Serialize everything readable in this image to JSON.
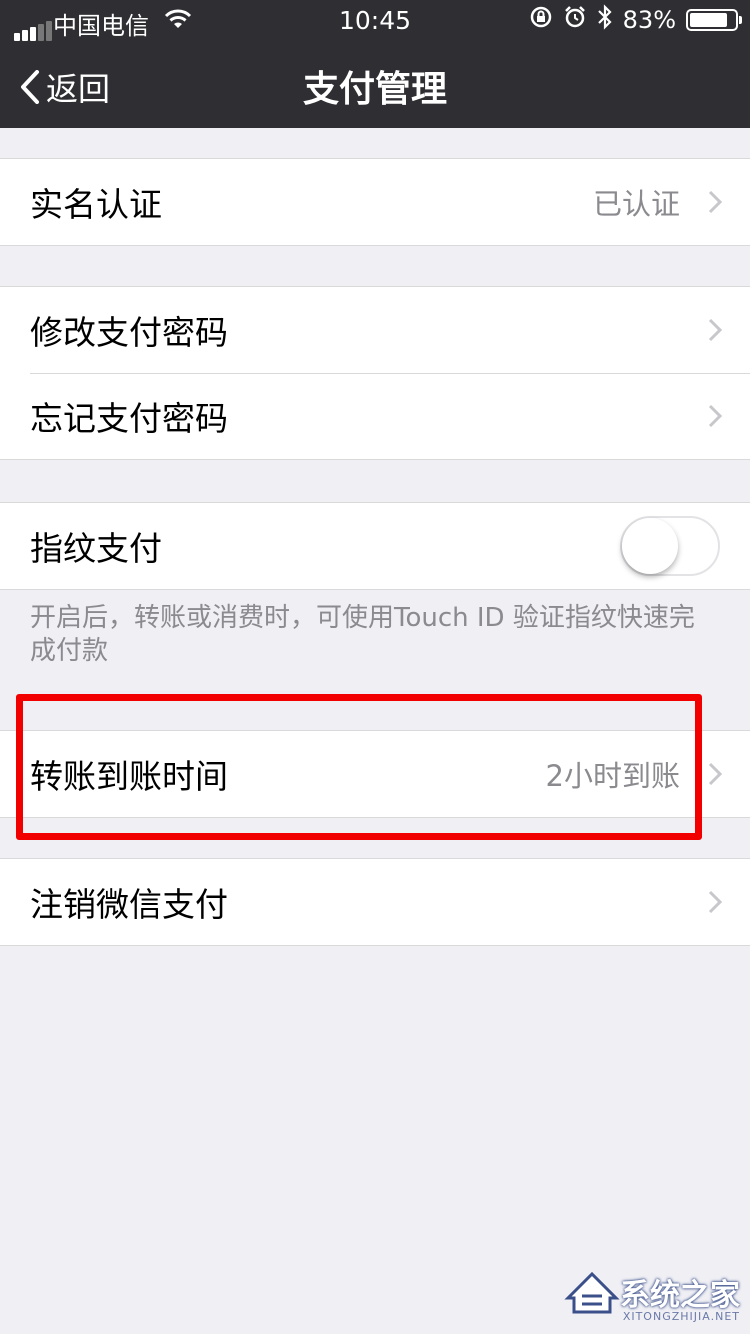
{
  "status_bar": {
    "carrier": "中国电信",
    "time": "10:45",
    "battery": "83%",
    "battery_level": 0.83
  },
  "nav": {
    "back_label": "返回",
    "title": "支付管理"
  },
  "rows": {
    "real_name": {
      "label": "实名认证",
      "value": "已认证"
    },
    "change_password": {
      "label": "修改支付密码"
    },
    "forgot_password": {
      "label": "忘记支付密码"
    },
    "fingerprint": {
      "label": "指纹支付",
      "enabled": false
    },
    "fingerprint_note": "开启后，转账或消费时，可使用Touch ID 验证指纹快速完成付款",
    "transfer_time": {
      "label": "转账到账时间",
      "value": "2小时到账"
    },
    "cancel_wechat_pay": {
      "label": "注销微信支付"
    }
  },
  "watermark": {
    "text": "系统之家",
    "url": "XITONGZHIJIA.NET"
  }
}
